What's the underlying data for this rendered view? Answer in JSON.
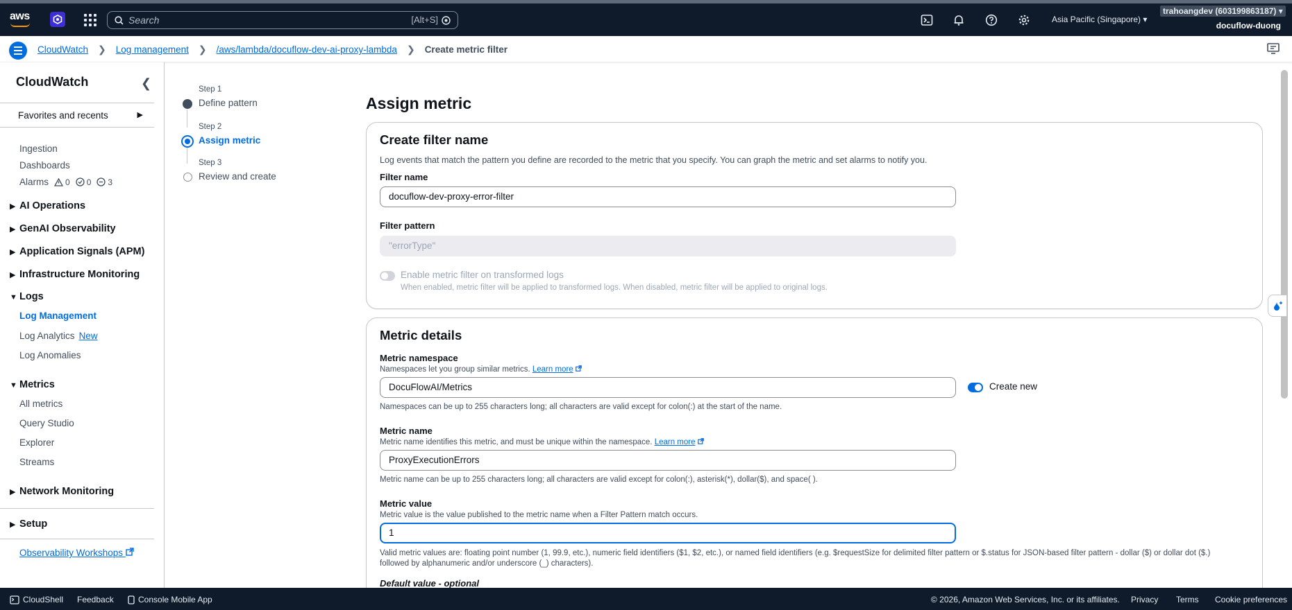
{
  "topnav": {
    "brand": "aws",
    "search_placeholder": "Search",
    "search_shortcut": "[Alt+S]",
    "region": "Asia Pacific (Singapore)",
    "account_id": "trahoangdev (603199863187)",
    "account_name": "docuflow-duong"
  },
  "breadcrumb": {
    "items": [
      "CloudWatch",
      "Log management",
      "/aws/lambda/docuflow-dev-ai-proxy-lambda"
    ],
    "current": "Create metric filter"
  },
  "sidebar": {
    "title": "CloudWatch",
    "favorites": "Favorites and recents",
    "top_items": [
      "Ingestion",
      "Dashboards"
    ],
    "alarms": {
      "label": "Alarms",
      "in_alarm": "0",
      "ok": "0",
      "insufficient": "3"
    },
    "sections": {
      "ai_operations": "AI Operations",
      "genai": "GenAI Observability",
      "app_signals": "Application Signals (APM)",
      "infra": "Infrastructure Monitoring",
      "logs": "Logs",
      "metrics": "Metrics",
      "network": "Network Monitoring",
      "setup": "Setup"
    },
    "logs_items": {
      "log_management": "Log Management",
      "log_analytics": "Log Analytics",
      "new_badge": "New",
      "log_anomalies": "Log Anomalies"
    },
    "metrics_items": [
      "All metrics",
      "Query Studio",
      "Explorer",
      "Streams"
    ],
    "workshops": "Observability Workshops"
  },
  "steps": [
    {
      "step": "Step 1",
      "name": "Define pattern",
      "state": "completed"
    },
    {
      "step": "Step 2",
      "name": "Assign metric",
      "state": "current"
    },
    {
      "step": "Step 3",
      "name": "Review and create",
      "state": "upcoming"
    }
  ],
  "page": {
    "title": "Assign metric",
    "filter_card": {
      "heading": "Create filter name",
      "description": "Log events that match the pattern you define are recorded to the metric that you specify. You can graph the metric and set alarms to notify you.",
      "filter_name_label": "Filter name",
      "filter_name_value": "docuflow-dev-proxy-error-filter",
      "filter_pattern_label": "Filter pattern",
      "filter_pattern_value": "\"errorType\"",
      "transform_toggle_label": "Enable metric filter on transformed logs",
      "transform_toggle_desc": "When enabled, metric filter will be applied to transformed logs. When disabled, metric filter will be applied to original logs."
    },
    "metric_card": {
      "heading": "Metric details",
      "namespace_label": "Metric namespace",
      "namespace_desc": "Namespaces let you group similar metrics.",
      "learn_more": "Learn more",
      "namespace_value": "DocuFlowAI/Metrics",
      "create_new_label": "Create new",
      "namespace_hint": "Namespaces can be up to 255 characters long; all characters are valid except for colon(:) at the start of the name.",
      "metric_name_label": "Metric name",
      "metric_name_desc": "Metric name identifies this metric, and must be unique within the namespace.",
      "metric_name_value": "ProxyExecutionErrors",
      "metric_name_hint": "Metric name can be up to 255 characters long; all characters are valid except for colon(:), asterisk(*), dollar($), and space( ).",
      "metric_value_label": "Metric value",
      "metric_value_desc": "Metric value is the value published to the metric name when a Filter Pattern match occurs.",
      "metric_value_value": "1",
      "metric_value_hint": "Valid metric values are: floating point number (1, 99.9, etc.), numeric field identifiers ($1, $2, etc.), or named field identifiers (e.g. $requestSize for delimited filter pattern or $.status for JSON-based filter pattern - dollar ($) or dollar dot ($.) followed by alphanumeric and/or underscore (_) characters).",
      "default_value_label": "Default value - optional"
    }
  },
  "footer": {
    "cloudshell": "CloudShell",
    "feedback": "Feedback",
    "mobile_app": "Console Mobile App",
    "copyright": "© 2026, Amazon Web Services, Inc. or its affiliates.",
    "privacy": "Privacy",
    "terms": "Terms",
    "cookies": "Cookie preferences"
  },
  "colors": {
    "accent": "#006ce0",
    "nav_bg": "#0f1b2a",
    "aws_orange": "#ff9900"
  }
}
